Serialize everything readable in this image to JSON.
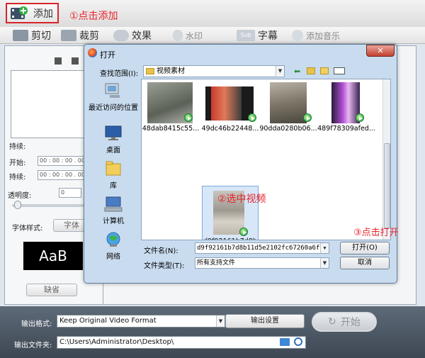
{
  "topbar": {
    "add_label": "添加"
  },
  "annotations": {
    "step1": "①点击添加",
    "step2": "②选中视频",
    "step3": "③点击打开"
  },
  "toolbar": {
    "items": [
      {
        "label": "剪切"
      },
      {
        "label": "裁剪"
      },
      {
        "label": "效果"
      },
      {
        "label": "水印"
      },
      {
        "label": "字幕"
      },
      {
        "label": "添加音乐"
      }
    ]
  },
  "left_panel": {
    "duration_label": "持续:",
    "start_label": "开始:",
    "duration2_label": "持续:",
    "start_value": "00 : 00 : 00 . 000",
    "duration_value": "00 : 00 : 00 . 000",
    "opacity_label": "透明度:",
    "opacity_value": "0",
    "font_style_label": "字体样式:",
    "font_button": "字体",
    "sample_text": "AaB",
    "bottom_button": "缺省"
  },
  "footer": {
    "format_label": "输出格式:",
    "format_value": "Keep Original Video Format",
    "settings_button": "输出设置",
    "start_button": "开始",
    "folder_label": "输出文件夹:",
    "folder_value": "C:\\Users\\Administrator\\Desktop\\"
  },
  "dialog": {
    "title": "打开",
    "look_in_label": "查找范围(I):",
    "look_in_value": "视频素材",
    "places": [
      {
        "label": "最近访问的位置"
      },
      {
        "label": "桌面"
      },
      {
        "label": "库"
      },
      {
        "label": "计算机"
      },
      {
        "label": "网络"
      }
    ],
    "files": [
      {
        "name": "48dab8415c55..."
      },
      {
        "name": "49dc46b22448..."
      },
      {
        "name": "90dda0280b06..."
      },
      {
        "name": "489f78309afed..."
      }
    ],
    "selected_file": "d9f92161b7d8b11d5e2102fc67260a6f",
    "file_name_label": "文件名(N):",
    "file_name_value": "d9f92161b7d8b11d5e2102fc67260a6f",
    "file_type_label": "文件类型(T):",
    "file_type_value": "所有支持文件",
    "open_button": "打开(O)",
    "cancel_button": "取消"
  }
}
